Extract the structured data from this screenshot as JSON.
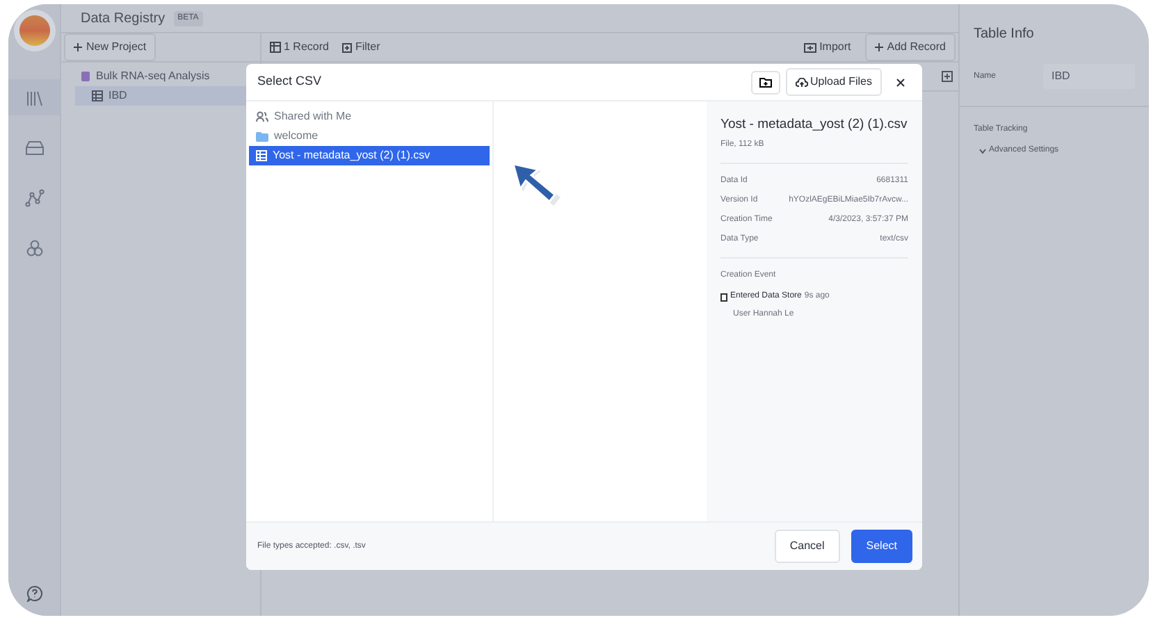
{
  "app": {
    "title": "Data Registry",
    "badge": "BETA",
    "new_project": "New Project",
    "tree": [
      {
        "label": "Bulk RNA-seq Analysis",
        "kind": "project",
        "selected": false,
        "children": [
          {
            "label": "IBD",
            "kind": "table",
            "selected": true
          }
        ]
      }
    ],
    "toolbar": {
      "record_count": "1 Record",
      "filter": "Filter",
      "import": "Import",
      "add_record": "Add Record"
    },
    "table_info": {
      "title": "Table Info",
      "fields": [
        {
          "label": "Name",
          "value": "IBD"
        }
      ],
      "section": "Table Tracking",
      "advanced": "Advanced Settings"
    }
  },
  "modal": {
    "title": "Select CSV",
    "upload": "Upload Files",
    "items": [
      {
        "label": "Shared with Me",
        "kind": "shared",
        "selected": false
      },
      {
        "label": "welcome",
        "kind": "folder",
        "selected": false
      },
      {
        "label": "Yost - metadata_yost (2) (1).csv",
        "kind": "table",
        "selected": true
      }
    ],
    "details": {
      "name": "Yost - metadata_yost (2) (1).csv",
      "subtitle": "File, 112 kB",
      "properties": [
        {
          "label": "Data Id",
          "value": "6681311"
        },
        {
          "label": "Version Id",
          "value": "hYOzlAEgEBiLMiae5Ib7rAvcw..."
        },
        {
          "label": "Creation Time",
          "value": "4/3/2023, 3:57:37 PM"
        },
        {
          "label": "Data Type",
          "value": "text/csv"
        }
      ],
      "event_heading": "Creation Event",
      "event": {
        "title": "Entered Data Store",
        "time": "9s ago",
        "user": "User Hannah Le"
      }
    },
    "footer_note": "File types accepted: .csv, .tsv",
    "buttons": [
      {
        "label": "Cancel",
        "kind": "secondary"
      },
      {
        "label": "Select",
        "kind": "primary"
      }
    ]
  }
}
